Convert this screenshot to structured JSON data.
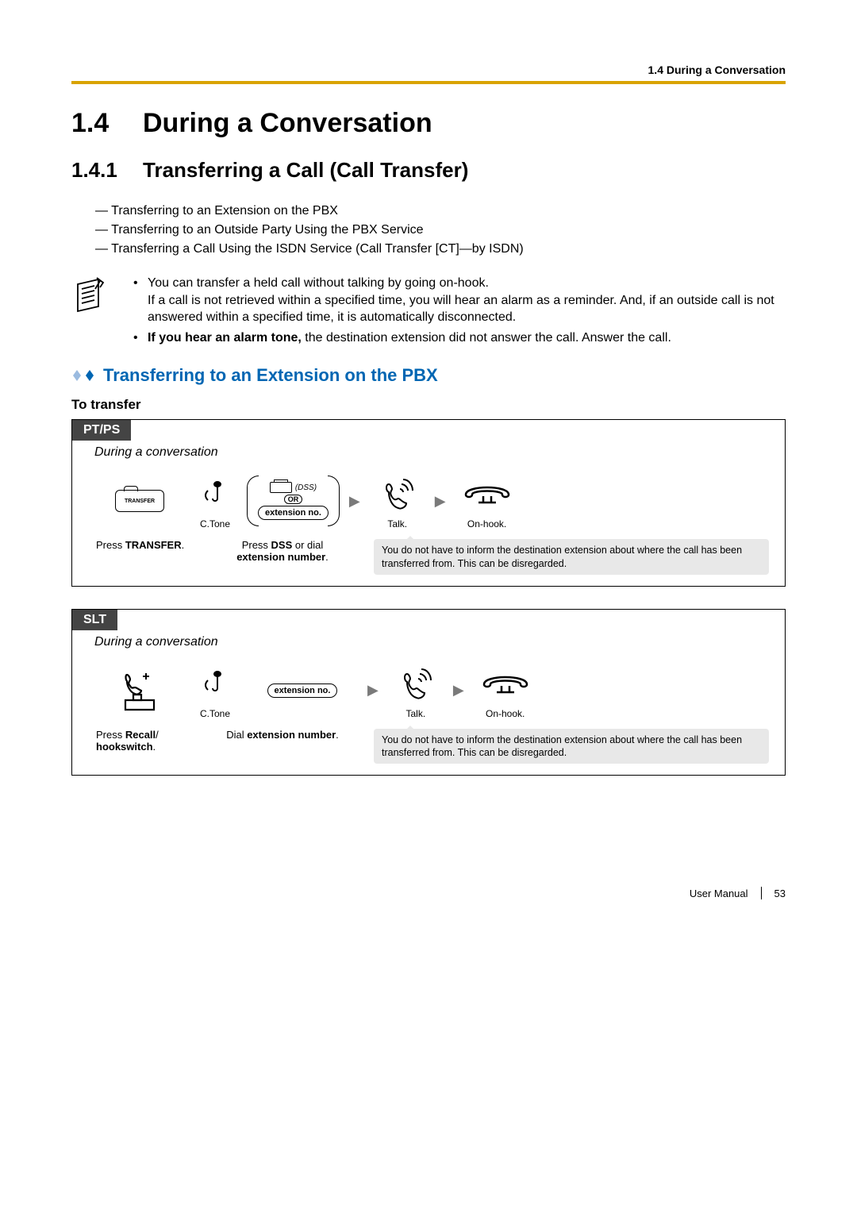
{
  "header": {
    "section": "1.4 During a Conversation"
  },
  "h1": {
    "num": "1.4",
    "title": "During a Conversation"
  },
  "h2": {
    "num": "1.4.1",
    "title": "Transferring a Call (Call Transfer)"
  },
  "toc": [
    "Transferring to an Extension on the PBX",
    "Transferring to an Outside Party Using the PBX Service",
    "Transferring a Call Using the ISDN Service (Call Transfer [CT]—by ISDN)"
  ],
  "notes": {
    "b1": "You can transfer a held call without talking by going on-hook.",
    "b1b": "If a call is not retrieved within a specified time, you will hear an alarm as a reminder. And, if an outside call is not answered within a specified time, it is automatically disconnected.",
    "b2_bold": "If you hear an alarm tone,",
    "b2_rest": " the destination extension did not answer the call. Answer the call."
  },
  "subhead": "Transferring to an Extension on the PBX",
  "to_transfer": "To transfer",
  "ptps": {
    "tab": "PT/PS",
    "context": "During a conversation",
    "transfer_key": "TRANSFER",
    "ctone": "C.Tone",
    "dss": "(DSS)",
    "or": "OR",
    "ext_no": "extension no.",
    "talk": "Talk.",
    "onhook": "On-hook.",
    "cap1_pre": "Press ",
    "cap1_bold": "TRANSFER",
    "cap1_post": ".",
    "cap2_pre": "Press ",
    "cap2_b1": "DSS",
    "cap2_mid": " or dial ",
    "cap2_b2": "extension number",
    "cap2_post": ".",
    "callout": "You do not have to inform the destination extension about where the call has been transferred from. This can be disregarded."
  },
  "slt": {
    "tab": "SLT",
    "context": "During a conversation",
    "ctone": "C.Tone",
    "ext_no": "extension no.",
    "talk": "Talk.",
    "onhook": "On-hook.",
    "cap1_pre": "Press ",
    "cap1_b1": "Recall",
    "cap1_mid": "/",
    "cap1_b2": "hookswitch",
    "cap1_post": ".",
    "cap2_pre": "Dial ",
    "cap2_b": "extension number",
    "cap2_post": ".",
    "callout": "You do not have to inform the destination extension about where the call has been transferred from. This can be disregarded."
  },
  "footer": {
    "manual": "User Manual",
    "page": "53"
  }
}
